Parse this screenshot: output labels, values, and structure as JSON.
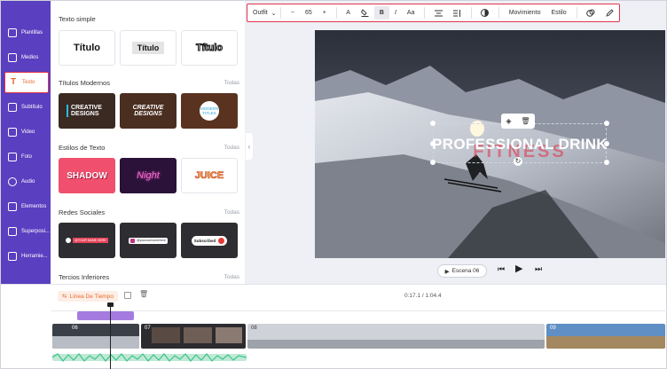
{
  "sidebar": {
    "items": [
      {
        "label": "Plantillas",
        "icon": "template-icon"
      },
      {
        "label": "Medios",
        "icon": "media-icon"
      },
      {
        "label": "Texto",
        "icon": "text-icon"
      },
      {
        "label": "Subtítulo",
        "icon": "subtitle-icon"
      },
      {
        "label": "Video",
        "icon": "video-icon"
      },
      {
        "label": "Foto",
        "icon": "photo-icon"
      },
      {
        "label": "Audio",
        "icon": "audio-icon"
      },
      {
        "label": "Elementos",
        "icon": "elements-icon"
      },
      {
        "label": "Superposi...",
        "icon": "overlay-icon"
      },
      {
        "label": "Herramie...",
        "icon": "tools-icon"
      }
    ],
    "active_index": 2
  },
  "panel": {
    "sections": [
      {
        "title": "Texto simple",
        "more": "",
        "items": [
          "Título",
          "Título",
          "Título"
        ]
      },
      {
        "title": "Títulos Modernos",
        "more": "Todas",
        "items": [
          "CREATIVE DESIGNS",
          "CREATIVE DESIGNS",
          "MODERN TITLES"
        ]
      },
      {
        "title": "Estilos de Texto",
        "more": "Todas",
        "items": [
          "SHADOW",
          "Night",
          "JUICE"
        ]
      },
      {
        "title": "Redes Sociales",
        "more": "Todas",
        "items": [
          "@YOUR NAME HERE",
          "@yourusernamehere",
          "Subscribed"
        ]
      },
      {
        "title": "Tercios Inferiores",
        "more": "Todas",
        "items": []
      }
    ]
  },
  "toolbar": {
    "font": "Outfit",
    "size_minus": "−",
    "font_size": "65",
    "size_plus": "+",
    "color_label": "A",
    "bold_label": "B",
    "italic_label": "I",
    "case_label": "Aa",
    "motion_label": "Movimiento",
    "style_label": "Estilo"
  },
  "stage": {
    "text": "PROFESSIONAL DRINK",
    "ghost_text": "FITNESS"
  },
  "player": {
    "scene_label": "Escena 06"
  },
  "timeline": {
    "label": "Línea De Tiempo",
    "time": "0:17.1 / 1:04.4",
    "clip_numbers": [
      "06",
      "07",
      "08",
      "09"
    ]
  },
  "colors": {
    "rail": "#5a3fc0",
    "accent": "#e86a2c",
    "highlight": "#e0334b",
    "text_clip": "#a57be0",
    "audio_wave": "#3ec48a"
  }
}
